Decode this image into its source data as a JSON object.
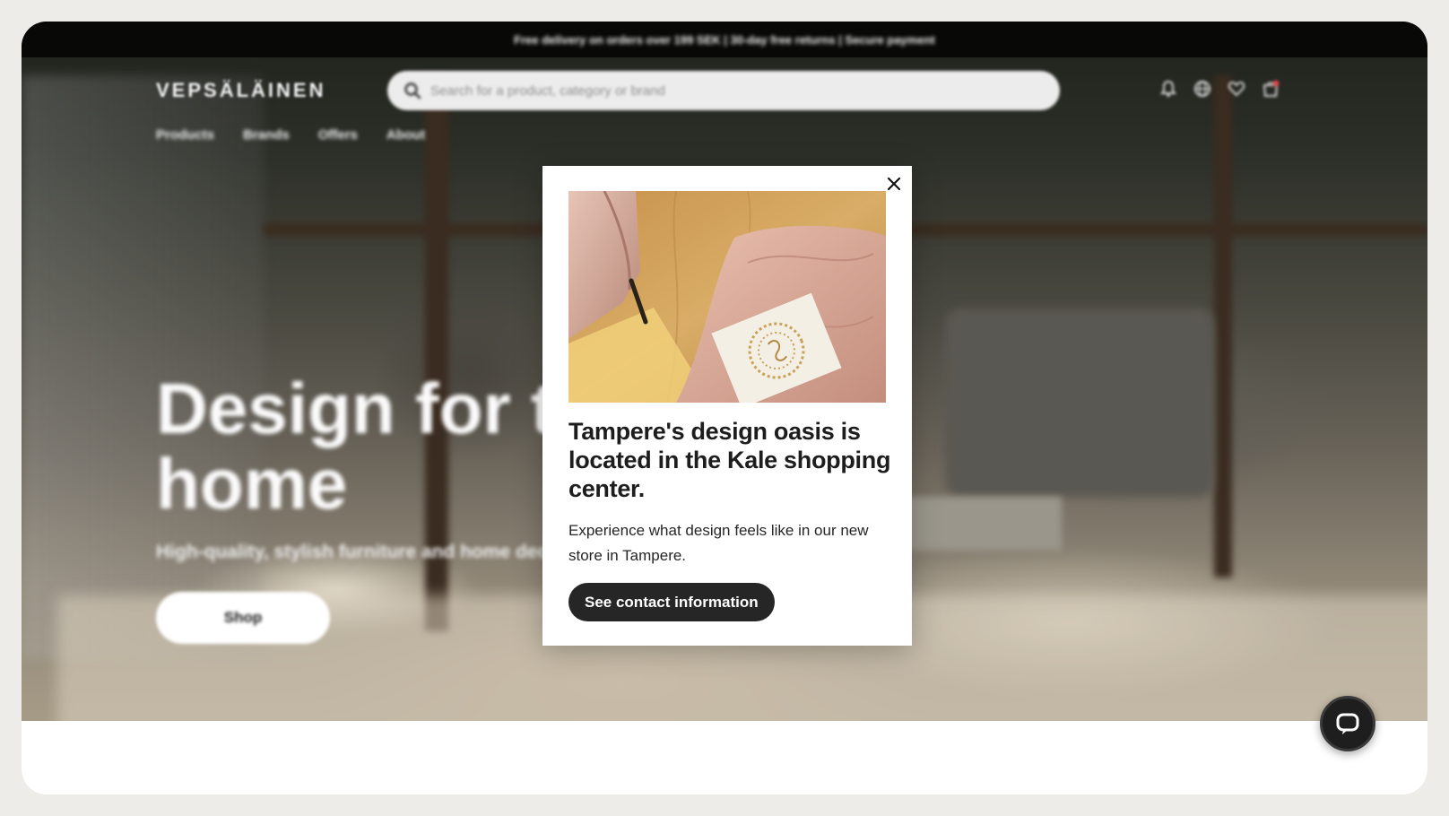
{
  "announcement": {
    "text": "Free delivery on orders over 199 SEK | 30-day free returns | Secure payment"
  },
  "header": {
    "logo": "VEPSÄLÄINEN",
    "search_placeholder": "Search for a product, category or brand",
    "icons": [
      "notification-bell-icon",
      "globe-icon",
      "heart-icon",
      "cart-icon"
    ]
  },
  "nav": {
    "items": [
      "Products",
      "Brands",
      "Offers",
      "About"
    ]
  },
  "hero": {
    "title_line1": "Design for the",
    "title_line2": "home",
    "subtitle": "High-quality, stylish furniture and home decor",
    "shop_label": "Shop"
  },
  "popup": {
    "close_icon": "close-icon",
    "title": "Tampere's design oasis is located in the Kale shopping center.",
    "text": "Experience what design feels like in our new store in Tampere.",
    "button_label": "See contact information"
  },
  "chat": {
    "icon": "chat-bubble-icon"
  },
  "colors": {
    "frame_bg": "#eeece8",
    "popup_button": "#262626",
    "top_bar": "#000000"
  }
}
